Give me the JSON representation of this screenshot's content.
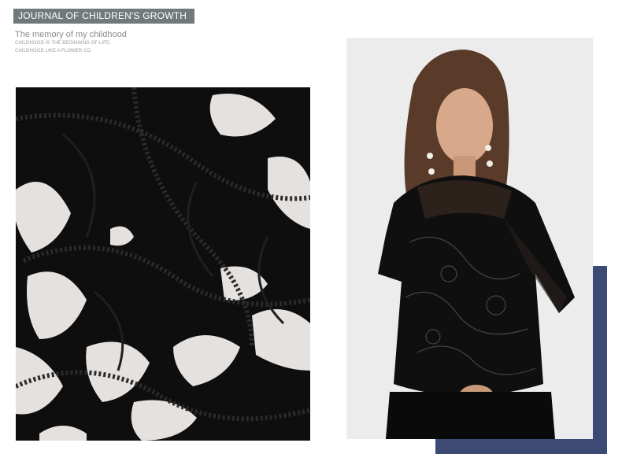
{
  "header": {
    "banner_text": "JOURNAL OF CHILDREN'S GROWTH",
    "subtitle": "The memory of my childhood",
    "caption_line1": "CHILDHOOD IS THE BEGINNING OF LIFE,",
    "caption_line2": "CHILDHOOD LIKE A FLOWER CO"
  },
  "colors": {
    "banner_bg": "#707a7a",
    "accent_block": "#3d4a74",
    "lace": "#0b0b0b"
  },
  "images": {
    "left": "black-lace-fabric-closeup",
    "right": "model-wearing-black-lace-blouse"
  }
}
